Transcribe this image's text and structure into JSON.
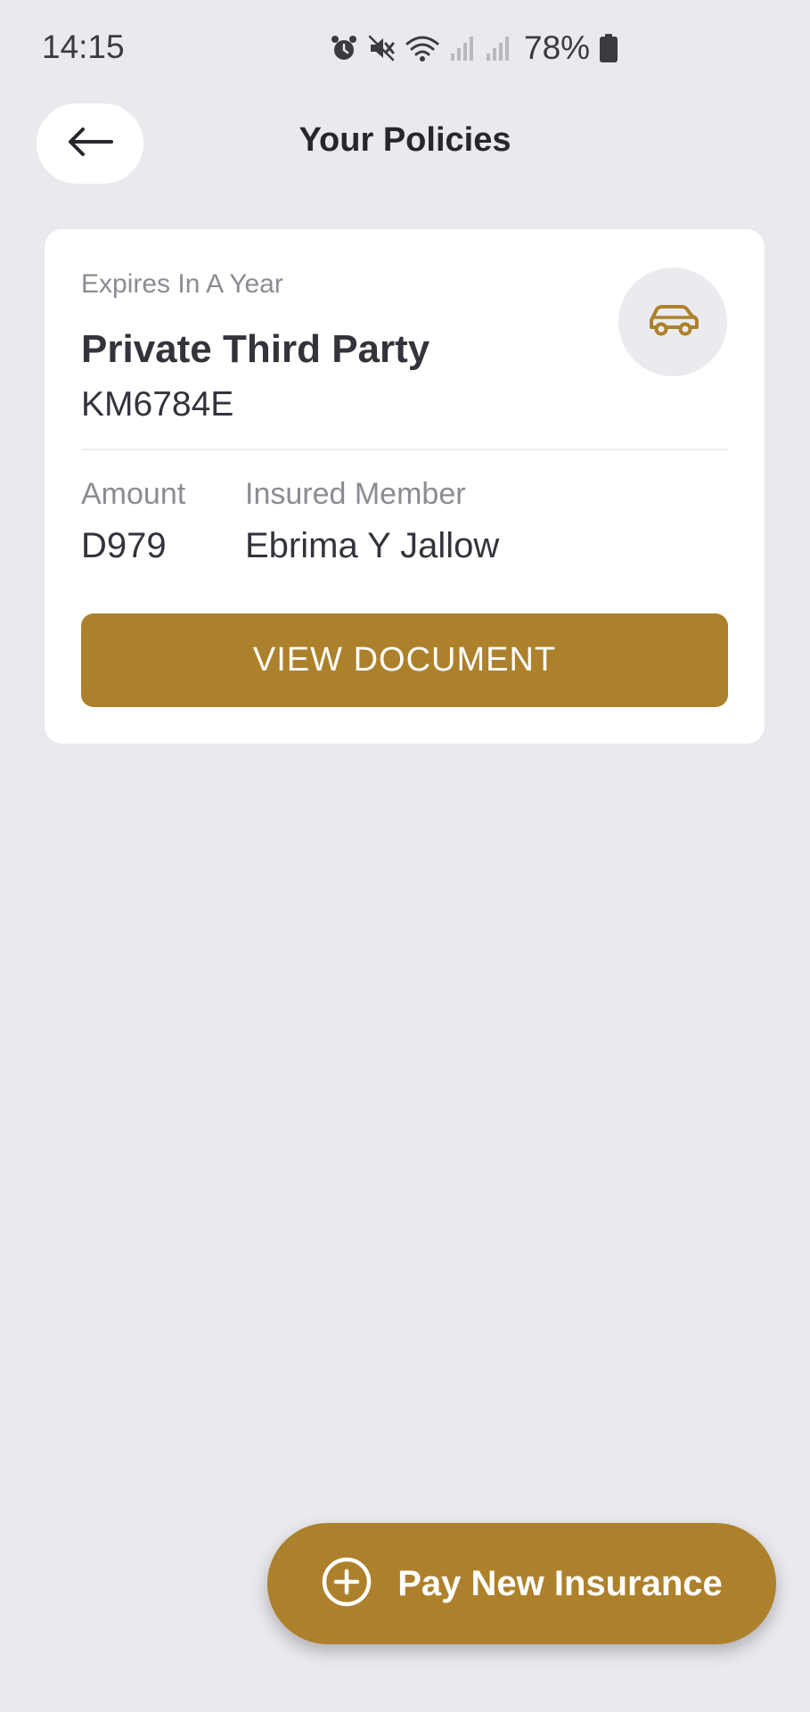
{
  "status_bar": {
    "time": "14:15",
    "battery": "78%",
    "icons": [
      "alarm-icon",
      "mute-icon",
      "wifi-icon",
      "signal-icon",
      "signal-icon",
      "battery-icon"
    ]
  },
  "header": {
    "title": "Your Policies",
    "back_icon": "arrow-left-icon"
  },
  "policy_card": {
    "expiry": "Expires In A Year",
    "name": "Private Third Party",
    "plate": "KM6784E",
    "vehicle_icon": "car-icon",
    "amount_label": "Amount",
    "amount_value": "D979",
    "member_label": "Insured Member",
    "member_value": "Ebrima Y Jallow",
    "button_label": "VIEW DOCUMENT"
  },
  "fab": {
    "label": "Pay New Insurance",
    "icon": "plus-circle-icon"
  },
  "colors": {
    "background": "#e9e9ee",
    "accent": "#ad812b",
    "card": "#ffffff"
  }
}
